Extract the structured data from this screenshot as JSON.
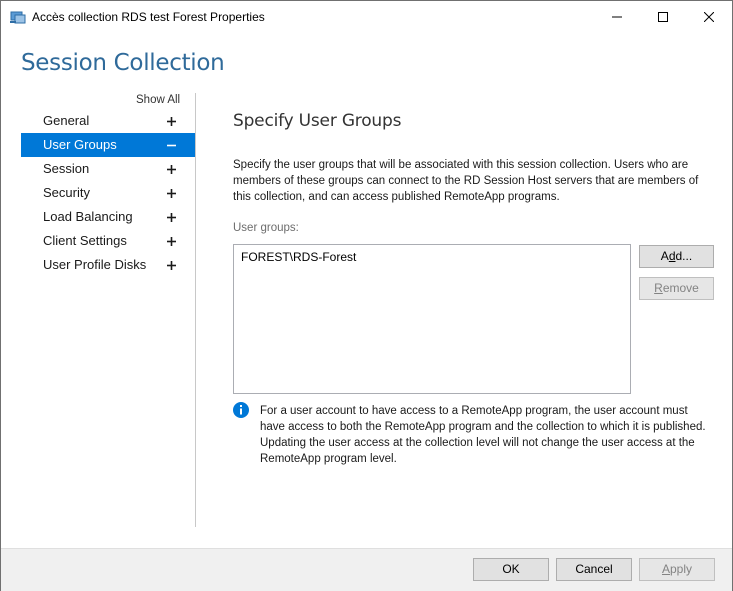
{
  "window": {
    "title": "Accès collection RDS test Forest Properties"
  },
  "header": {
    "title": "Session Collection"
  },
  "sidebar": {
    "show_all": "Show All",
    "items": [
      {
        "label": "General",
        "sign": "+"
      },
      {
        "label": "User Groups",
        "sign": "−",
        "selected": true
      },
      {
        "label": "Session",
        "sign": "+"
      },
      {
        "label": "Security",
        "sign": "+"
      },
      {
        "label": "Load Balancing",
        "sign": "+"
      },
      {
        "label": "Client Settings",
        "sign": "+"
      },
      {
        "label": "User Profile Disks",
        "sign": "+"
      }
    ]
  },
  "content": {
    "section_title": "Specify User Groups",
    "description": "Specify the user groups that will be associated with this session collection. Users who are members of these groups can connect to the RD Session Host servers that are members of this collection, and can access published RemoteApp programs.",
    "groups_label": "User groups:",
    "groups": [
      "FOREST\\RDS-Forest"
    ],
    "add_prefix": "A",
    "add_underline": "d",
    "add_suffix": "d...",
    "remove_underline": "R",
    "remove_suffix": "emove",
    "info_text": "For a user account to have access to a RemoteApp program, the user account must have access to both the RemoteApp program and the collection to which it is published. Updating the user access at the collection level will not change the user access at the RemoteApp program level."
  },
  "footer": {
    "ok_label": "OK",
    "cancel_label": "Cancel",
    "apply_underline": "A",
    "apply_suffix": "pply"
  },
  "colors": {
    "accent": "#0078d7",
    "header_text": "#2f6a9a",
    "footer_bg": "#f0f0f0"
  }
}
